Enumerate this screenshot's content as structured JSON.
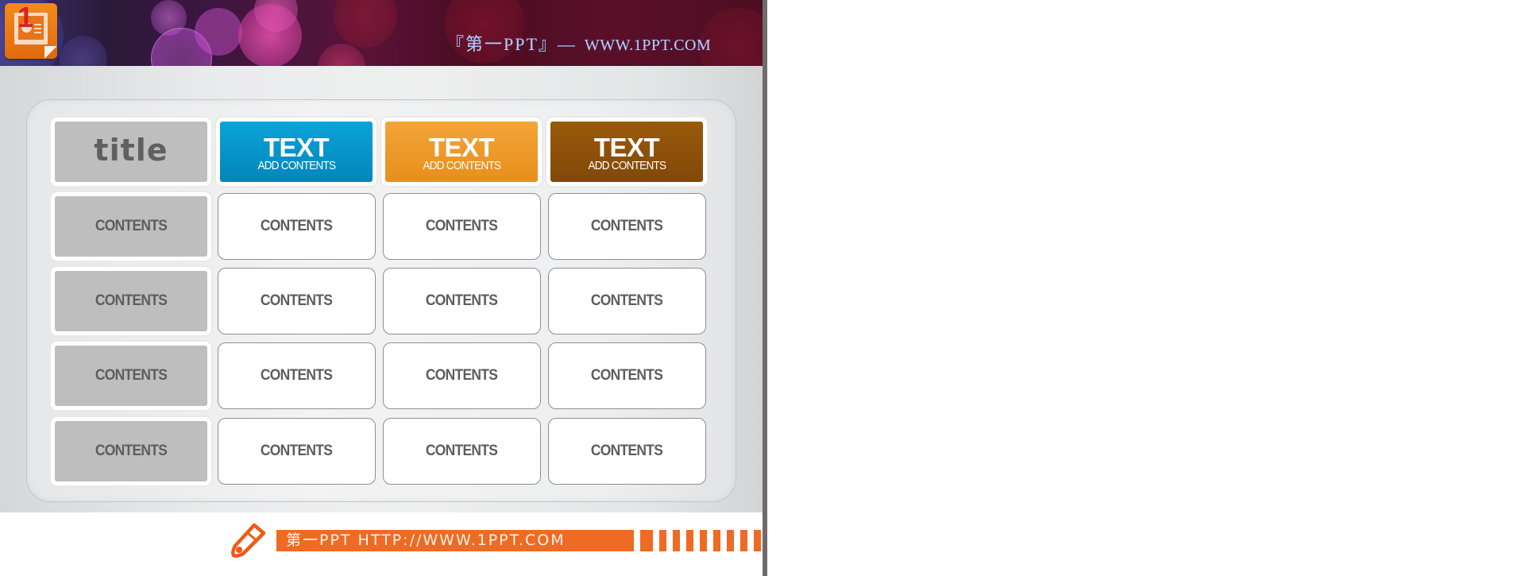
{
  "header": {
    "icon": "presentation-icon",
    "icon_badge": "1",
    "brand": "『第一PPT』—",
    "url": "WWW.1PPT.COM"
  },
  "table": {
    "header_row": [
      {
        "big": "title",
        "small": "",
        "style": "gray",
        "color": "#bebebe"
      },
      {
        "big": "TEXT",
        "small": "ADD CONTENTS",
        "style": "blue",
        "color": "#0591c7"
      },
      {
        "big": "TEXT",
        "small": "ADD CONTENTS",
        "style": "orange",
        "color": "#ef9a26"
      },
      {
        "big": "TEXT",
        "small": "ADD CONTENTS",
        "style": "brown",
        "color": "#8e4f06"
      }
    ],
    "rows": [
      [
        "CONTENTS",
        "CONTENTS",
        "CONTENTS",
        "CONTENTS"
      ],
      [
        "CONTENTS",
        "CONTENTS",
        "CONTENTS",
        "CONTENTS"
      ],
      [
        "CONTENTS",
        "CONTENTS",
        "CONTENTS",
        "CONTENTS"
      ],
      [
        "CONTENTS",
        "CONTENTS",
        "CONTENTS",
        "CONTENTS"
      ]
    ]
  },
  "footer": {
    "icon": "pencil-icon",
    "text": "第一PPT HTTP://WWW.1PPT.COM",
    "accent_color": "#ef6a23"
  }
}
